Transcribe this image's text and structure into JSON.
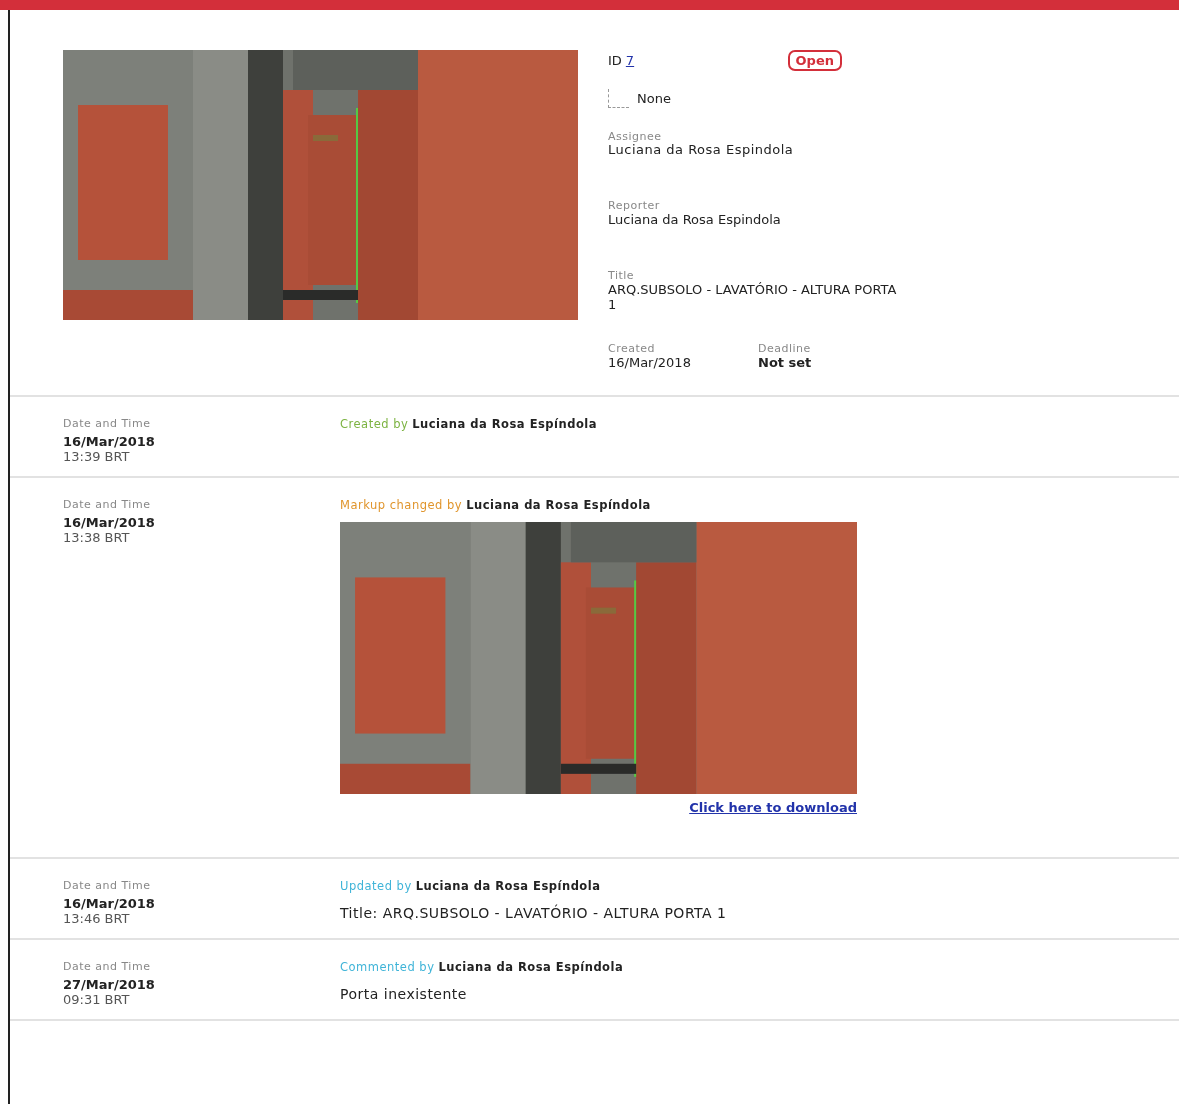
{
  "issue": {
    "id_label": "ID",
    "id": "7",
    "status": "Open",
    "priority": "None",
    "fields": [
      {
        "label": "Assignee",
        "value": "Luciana da Rosa Espindola"
      },
      {
        "label": "Reporter",
        "value": "Luciana da Rosa Espindola"
      },
      {
        "label": "Title",
        "value": "ARQ.SUBSOLO - LAVATÓRIO - ALTURA PORTA 1"
      }
    ],
    "created_label": "Created",
    "created": "16/Mar/2018",
    "deadline_label": "Deadline",
    "deadline": "Not set"
  },
  "activity": [
    {
      "kind": "created",
      "date_label": "Date and Time",
      "date": "16/Mar/2018",
      "time": "13:39 BRT",
      "action": "Created by",
      "author": "Luciana da Rosa Espíndola"
    },
    {
      "kind": "markup",
      "date_label": "Date and Time",
      "date": "16/Mar/2018",
      "time": "13:38 BRT",
      "action": "Markup changed by",
      "author": "Luciana da Rosa Espíndola",
      "link": "Click here to download"
    },
    {
      "kind": "updated",
      "date_label": "Date and Time",
      "date": "16/Mar/2018",
      "time": "13:46 BRT",
      "action": "Updated by",
      "author": "Luciana da Rosa Espíndola",
      "text": "Title: ARQ.SUBSOLO - LAVATÓRIO - ALTURA PORTA 1"
    },
    {
      "kind": "commented",
      "date_label": "Date and Time",
      "date": "27/Mar/2018",
      "time": "09:31 BRT",
      "action": "Commented by",
      "author": "Luciana da Rosa Espíndola",
      "text": "Porta inexistente"
    }
  ]
}
